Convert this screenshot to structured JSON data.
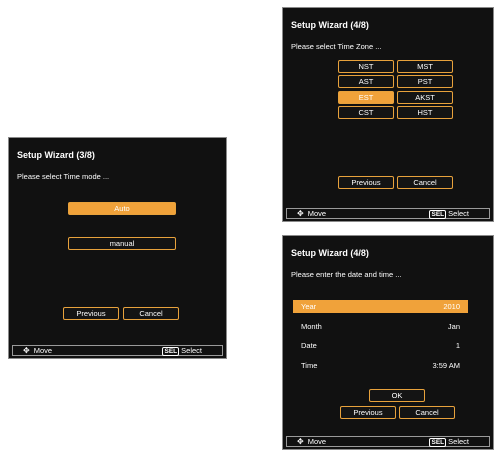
{
  "panel_left": {
    "title": "Setup Wizard (3/8)",
    "prompt": "Please select Time mode ...",
    "options": [
      "Auto",
      "manual"
    ],
    "selected": "Auto",
    "buttons": {
      "previous": "Previous",
      "cancel": "Cancel"
    }
  },
  "panel_tz": {
    "title": "Setup Wizard (4/8)",
    "prompt": "Please select Time Zone ...",
    "zones": [
      [
        "NST",
        "MST"
      ],
      [
        "AST",
        "PST"
      ],
      [
        "EST",
        "AKST"
      ],
      [
        "CST",
        "HST"
      ]
    ],
    "selected": "EST",
    "buttons": {
      "previous": "Previous",
      "cancel": "Cancel"
    }
  },
  "panel_date": {
    "title": "Setup Wizard (4/8)",
    "prompt": "Please enter the date and time ...",
    "fields": [
      {
        "label": "Year",
        "value": "2010"
      },
      {
        "label": "Month",
        "value": "Jan"
      },
      {
        "label": "Date",
        "value": "1"
      },
      {
        "label": "Time",
        "value": "3:59 AM"
      }
    ],
    "selected_field": "Year",
    "buttons": {
      "ok": "OK",
      "previous": "Previous",
      "cancel": "Cancel"
    }
  },
  "footer": {
    "move_icon": "four-way-arrow-icon",
    "move_label": "Move",
    "sel_badge": "SEL",
    "select_label": "Select"
  },
  "colors": {
    "accent": "#f0a23a",
    "panel_bg": "#111111",
    "border": "#8a8a8a"
  }
}
